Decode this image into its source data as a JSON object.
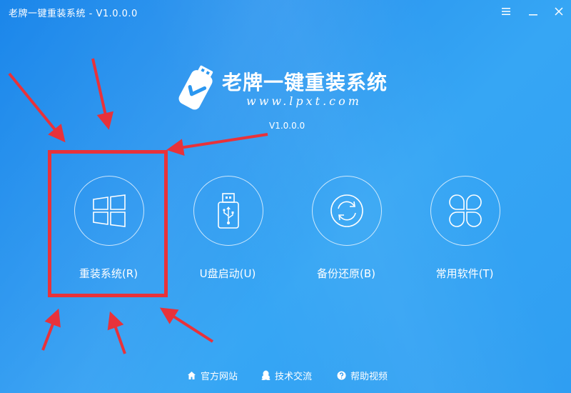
{
  "window": {
    "title": "老牌一键重装系统 - V1.0.0.0"
  },
  "logo": {
    "app_name": "老牌一键重装系统",
    "site": "www.lpxt.com",
    "version": "V1.0.0.0"
  },
  "features": [
    {
      "label": "重装系统(R)",
      "icon": "windows-logo-icon"
    },
    {
      "label": "U盘启动(U)",
      "icon": "usb-drive-icon"
    },
    {
      "label": "备份还原(B)",
      "icon": "refresh-cycle-icon"
    },
    {
      "label": "常用软件(T)",
      "icon": "four-leaf-icon"
    }
  ],
  "footer": [
    {
      "label": "官方网站",
      "icon": "home-icon"
    },
    {
      "label": "技术交流",
      "icon": "penguin-icon"
    },
    {
      "label": "帮助视频",
      "icon": "help-icon"
    }
  ],
  "colors": {
    "background": "#2b97f0",
    "highlight": "#e8323a",
    "text": "#ffffff"
  }
}
